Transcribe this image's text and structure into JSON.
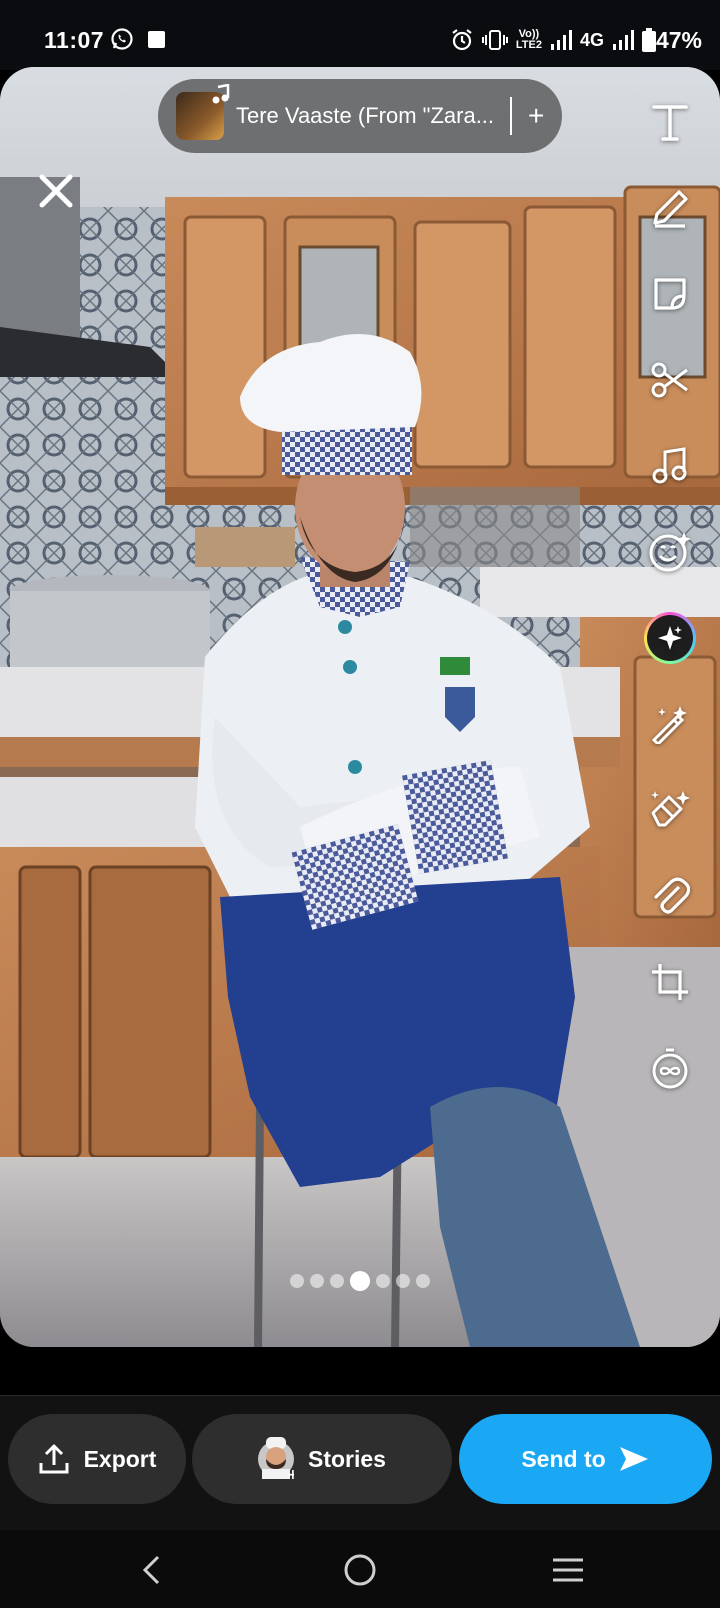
{
  "status_bar": {
    "time": "11:07",
    "volte_label_top": "Vo))",
    "volte_label_bottom": "LTE2",
    "network": "4G",
    "battery_pct": "47%"
  },
  "snap": {
    "music_title": "Tere Vaaste (From \"Zara...",
    "music_add": "+",
    "pagination": {
      "count": 7,
      "active_index": 3
    },
    "tools": [
      {
        "name": "text-icon"
      },
      {
        "name": "pen-icon"
      },
      {
        "name": "sticker-icon"
      },
      {
        "name": "scissors-icon"
      },
      {
        "name": "music-note-icon"
      },
      {
        "name": "lens-emoji-icon"
      },
      {
        "name": "ai-sparkle-icon"
      },
      {
        "name": "magic-wand-icon"
      },
      {
        "name": "eraser-icon"
      },
      {
        "name": "paperclip-icon"
      },
      {
        "name": "crop-icon"
      },
      {
        "name": "timer-infinity-icon"
      }
    ]
  },
  "action_bar": {
    "export_label": "Export",
    "stories_label": "Stories",
    "send_label": "Send to"
  },
  "colors": {
    "send_button": "#1aa7f4",
    "dark_button": "#2e2e2e",
    "background": "#121212"
  }
}
